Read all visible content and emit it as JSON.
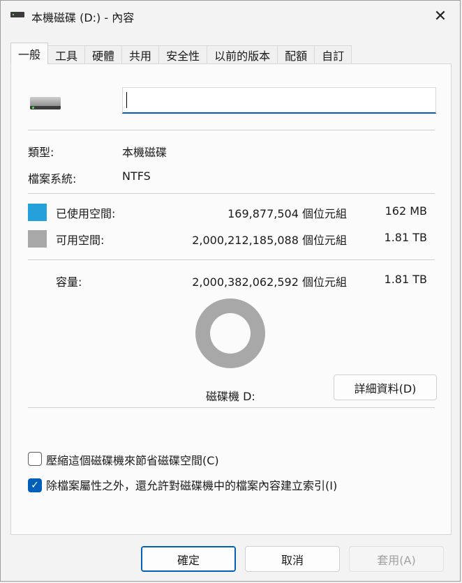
{
  "window": {
    "title": "本機磁碟 (D:) - 內容",
    "close_glyph": "✕"
  },
  "tabs": [
    "一般",
    "工具",
    "硬體",
    "共用",
    "安全性",
    "以前的版本",
    "配額",
    "自訂"
  ],
  "general": {
    "name_value": "",
    "type_label": "類型:",
    "type_value": "本機磁碟",
    "fs_label": "檔案系統:",
    "fs_value": "NTFS",
    "used_label": "已使用空間:",
    "used_bytes": "169,877,504 個位元組",
    "used_size": "162 MB",
    "free_label": "可用空間:",
    "free_bytes": "2,000,212,185,088 個位元組",
    "free_size": "1.81 TB",
    "capacity_label": "容量:",
    "capacity_bytes": "2,000,382,062,592 個位元組",
    "capacity_size": "1.81 TB",
    "drive_label": "磁碟機 D:",
    "details_button": "詳細資料(D)",
    "compress_label": "壓縮這個磁碟機來節省磁碟空間(C)",
    "index_label": "除檔案屬性之外，還允許對磁碟機中的檔案內容建立索引(I)",
    "checkmark": "✓"
  },
  "colors": {
    "used": "#26a0da",
    "free": "#a8a8a8",
    "accent": "#005fb8"
  },
  "footer": {
    "ok": "確定",
    "cancel": "取消",
    "apply": "套用(A)"
  }
}
